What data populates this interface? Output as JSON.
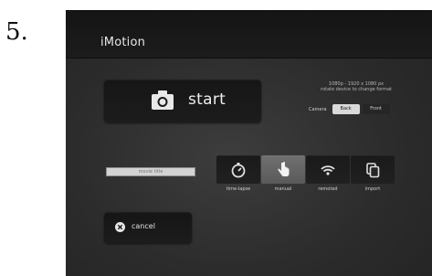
{
  "step": {
    "number": "5."
  },
  "app": {
    "title": "iMotion"
  },
  "start_button": {
    "label": "start",
    "icon": "camera-icon"
  },
  "format_info": {
    "line1": "1080p - 1920 x 1080 px",
    "line2": "rotate device to change format"
  },
  "camera": {
    "label": "Camera",
    "options": [
      "Back",
      "Front"
    ],
    "selected": "Back"
  },
  "movie_title": {
    "placeholder": "movie title",
    "value": ""
  },
  "modes": [
    {
      "label": "time-lapse",
      "icon": "timer-icon",
      "selected": false
    },
    {
      "label": "manual",
      "icon": "hand-pointer-icon",
      "selected": true
    },
    {
      "label": "remoted",
      "icon": "wifi-icon",
      "selected": false
    },
    {
      "label": "import",
      "icon": "import-icon",
      "selected": false
    }
  ],
  "cancel_button": {
    "label": "cancel",
    "icon": "cancel-icon"
  },
  "colors": {
    "background": "#2c2c2c",
    "topbar": "#161616",
    "button": "#1a1a1a",
    "selected_mode": "#656565",
    "text": "#e6e6e6"
  }
}
